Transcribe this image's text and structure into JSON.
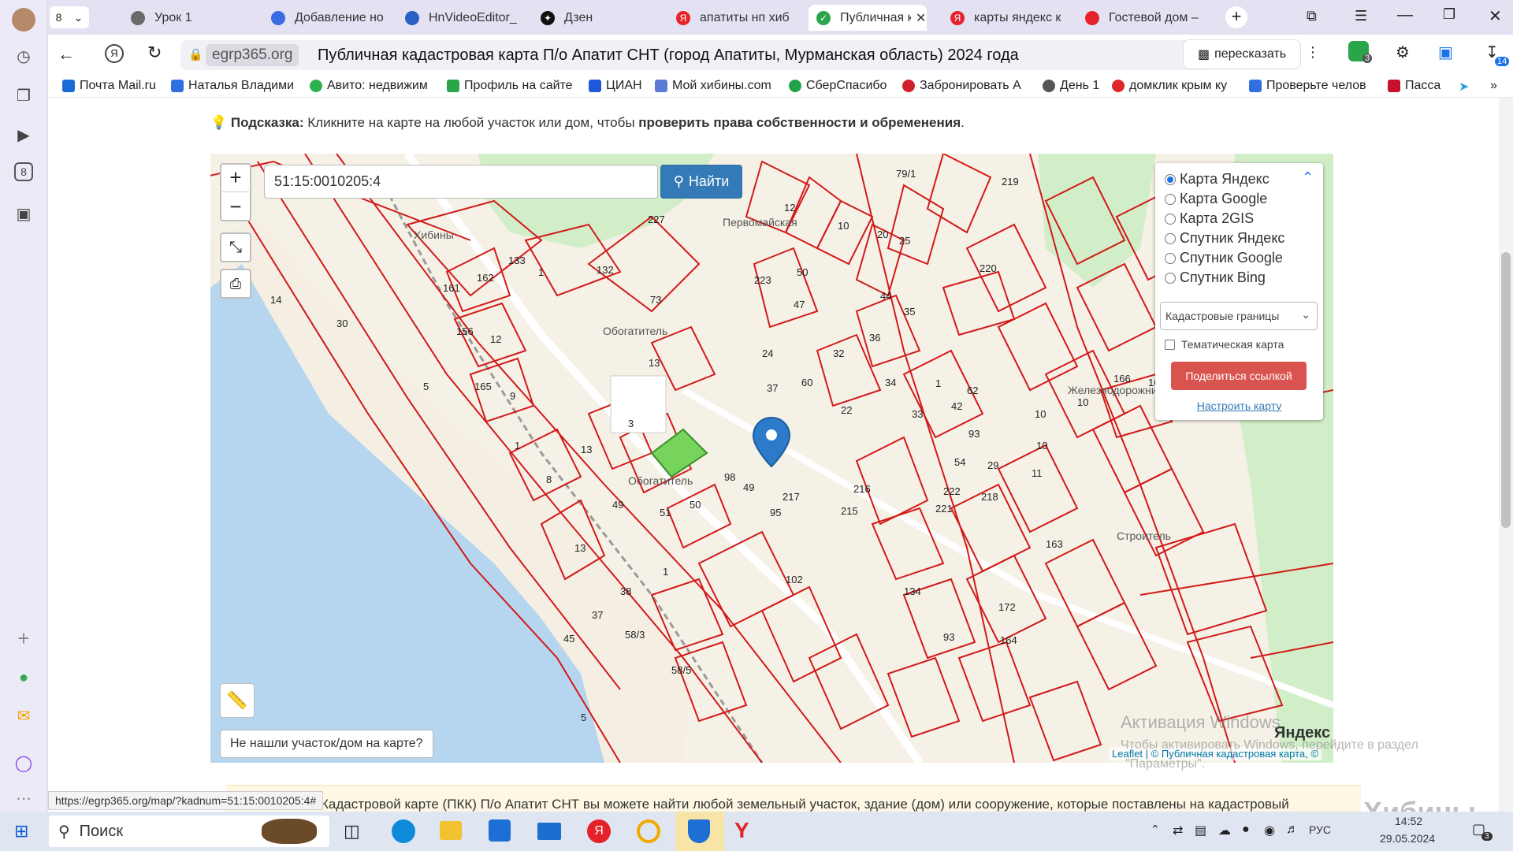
{
  "browser": {
    "tab_count": "8",
    "tabs": [
      {
        "label": "Урок 1"
      },
      {
        "label": "Добавление но"
      },
      {
        "label": "HnVideoEditor_"
      },
      {
        "label": "Дзен"
      },
      {
        "label": "апатиты нп хиб"
      },
      {
        "label": "Публичная к"
      },
      {
        "label": "карты яндекс к"
      },
      {
        "label": "Гостевой дом –"
      }
    ],
    "domain": "egrp365.org",
    "page_title": "Публичная кадастровая карта П/о Апатит СНТ (город Апатиты, Мурманская область) 2024 года",
    "retell": "пересказать",
    "badge_count": "14",
    "badge_small": "3",
    "bookmarks": [
      {
        "label": "Почта Mail.ru",
        "color": "#1a6dd6"
      },
      {
        "label": "Наталья Владими",
        "color": "#2f6fe0"
      },
      {
        "label": "Авито: недвижим",
        "color": "#2bb24c"
      },
      {
        "label": "Профиль на сайте",
        "color": "#2aa54a"
      },
      {
        "label": "ЦИАН",
        "color": "#1f58d8"
      },
      {
        "label": "Мой хибины.com",
        "color": "#5b7bd5"
      },
      {
        "label": "СберСпасибо",
        "color": "#1fa349"
      },
      {
        "label": "Забронировать А",
        "color": "#d0202b"
      },
      {
        "label": "День 1",
        "color": "#555555"
      },
      {
        "label": "домклик крым ку",
        "color": "#e0262a"
      },
      {
        "label": "Проверьте челов",
        "color": "#2f6fe0"
      },
      {
        "label": "Пасса",
        "color": "#c8102e"
      }
    ]
  },
  "hint": {
    "prefix": "Подсказка:",
    "text": " Кликните на карте на любой участок или дом, чтобы ",
    "bold": "проверить права собственности и обременения",
    "suffix": "."
  },
  "search": {
    "value": "51:15:0010205:4",
    "button": "Найти"
  },
  "map": {
    "not_found": "Не нашли участок/дом на карте?",
    "yandex_mark": "Яндекс",
    "attribution_leaflet": "Leaflet",
    "attribution_rest": "| © Публичная кадастровая карта, ©",
    "activation_title": "Активация Windows",
    "activation_text": "Чтобы активировать Windows, перейдите в раздел",
    "activation_text2": "\"Параметры\".",
    "places": {
      "khibiny": "Хибины",
      "obogatitel1": "Обогатитель",
      "obogatitel2": "Обогатитель",
      "zheleznodorozhnik": "Железнодорожник",
      "stroitel": "Строитель",
      "pervomay": "Первомайская"
    }
  },
  "layers": {
    "options": [
      "Карта Яндекс",
      "Карта Google",
      "Карта 2GIS",
      "Спутник Яндекс",
      "Спутник Google",
      "Спутник Bing"
    ],
    "selected": "Карта Яндекс",
    "select_value": "Кадастровые границы",
    "thematic": "Тематическая карта",
    "share": "Поделиться ссылкой",
    "configure": "Настроить карту"
  },
  "below_map": {
    "text": "Кадастровой карте (ПКК) П/о Апатит СНТ вы можете найти любой земельный участок, здание (дом) или сооружение, которые поставлены на кадастровый",
    "status_url": "https://egrp365.org/map/?kadnum=51:15:0010205:4#"
  },
  "watermark": "Хибины",
  "taskbar": {
    "search": "Поиск",
    "lang": "РУС",
    "time": "14:52",
    "date": "29.05.2024",
    "notif": "3"
  },
  "colors": {
    "accent_button": "#337ab7",
    "share_button": "#d9534f",
    "parcel_line": "#d11a1a",
    "water": "#b6d5ee",
    "forest": "#d2eec8",
    "selected_parcel": "#76d35c"
  }
}
